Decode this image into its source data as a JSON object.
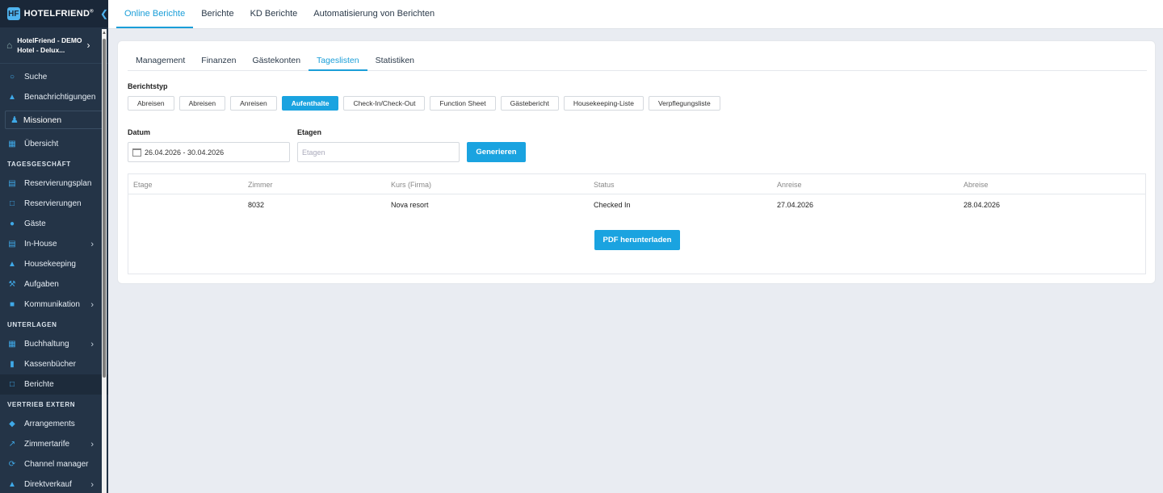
{
  "brand": {
    "name": "HOTELFRIEND",
    "mark": "HF"
  },
  "hotel": {
    "line1": "HotelFriend - DEMO",
    "line2": "Hotel - Delux..."
  },
  "sidebar": {
    "search": "Suche",
    "notifications": "Benachrichtigungen",
    "missions": "Missionen",
    "overview": "Übersicht",
    "section_tagesgeschaeft": "TAGESGESCHÄFT",
    "reservierungsplan": "Reservierungsplan",
    "reservierungen": "Reservierungen",
    "gaeste": "Gäste",
    "inhouse": "In-House",
    "housekeeping": "Housekeeping",
    "aufgaben": "Aufgaben",
    "kommunikation": "Kommunikation",
    "section_unterlagen": "UNTERLAGEN",
    "buchhaltung": "Buchhaltung",
    "kassenbuecher": "Kassenbücher",
    "berichte": "Berichte",
    "section_vertrieb": "VERTRIEB EXTERN",
    "arrangements": "Arrangements",
    "zimmertarife": "Zimmertarife",
    "channel_manager": "Channel manager",
    "direktverkauf": "Direktverkauf"
  },
  "topnav": {
    "online_berichte": "Online Berichte",
    "berichte": "Berichte",
    "kd_berichte": "KD Berichte",
    "automatisierung": "Automatisierung von Berichten"
  },
  "subtabs": {
    "management": "Management",
    "finanzen": "Finanzen",
    "gaestekonten": "Gästekonten",
    "tageslisten": "Tageslisten",
    "statistiken": "Statistiken"
  },
  "report_type": {
    "label": "Berichtstyp",
    "options": [
      "Abreisen",
      "Abreisen",
      "Anreisen",
      "Aufenthalte",
      "Check-In/Check-Out",
      "Function Sheet",
      "Gästebericht",
      "Housekeeping-Liste",
      "Verpflegungsliste"
    ],
    "selected": "Aufenthalte"
  },
  "form": {
    "datum_label": "Datum",
    "datum_value": "26.04.2026 - 30.04.2026",
    "etagen_label": "Etagen",
    "etagen_placeholder": "Etagen",
    "generate_button": "Generieren"
  },
  "table": {
    "columns": [
      "Etage",
      "Zimmer",
      "Kurs (Firma)",
      "Status",
      "Anreise",
      "Abreise"
    ],
    "rows": [
      [
        "",
        "8032",
        "Nova resort",
        "Checked In",
        "27.04.2026",
        "28.04.2026"
      ]
    ],
    "download_button": "PDF herunterladen"
  },
  "colors": {
    "accent": "#1aa3e0",
    "sidebar_bg": "#243447"
  }
}
